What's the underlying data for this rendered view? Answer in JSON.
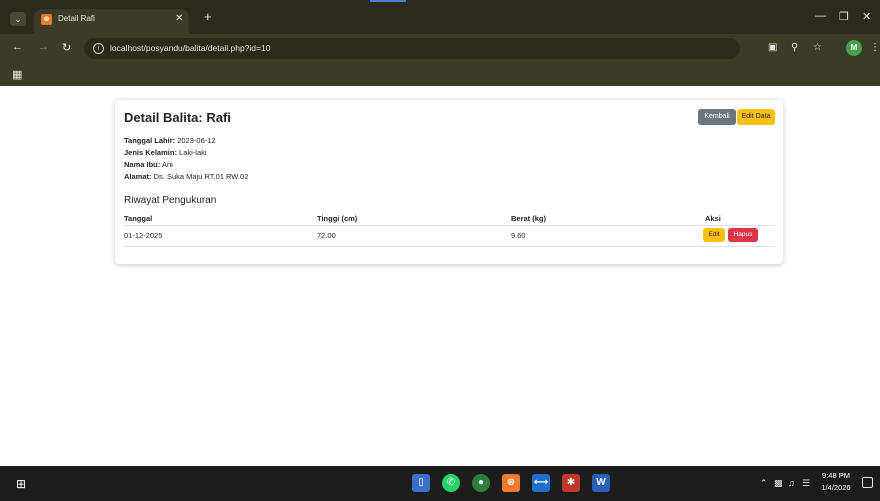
{
  "browser": {
    "tab_title": "Detail Rafi",
    "tab_favicon": "XAMPP",
    "url": "localhost/posyandu/balita/detail.php?id=10",
    "profile_initial": "M"
  },
  "page": {
    "title": "Detail Balita: Rafi",
    "buttons": {
      "kembali": "Kembali",
      "edit_data": "Edit Data"
    },
    "info": [
      {
        "label": "Tanggal Lahir:",
        "value": "2023-06-12"
      },
      {
        "label": "Jenis Kelamin:",
        "value": "Laki-laki"
      },
      {
        "label": "Nama Ibu:",
        "value": "Ani"
      },
      {
        "label": "Alamat:",
        "value": "Ds. Suka Maju RT.01 RW.02"
      }
    ],
    "history_title": "Riwayat Pengukuran",
    "table": {
      "headers": [
        "Tanggal",
        "Tinggi (cm)",
        "Berat (kg)",
        "Aksi"
      ],
      "rows": [
        {
          "tanggal": "01-12-2025",
          "tinggi": "72.00",
          "berat": "9.60",
          "edit": "Edit",
          "hapus": "Hapus"
        }
      ]
    }
  },
  "taskbar": {
    "time": "9:48 PM",
    "date": "1/4/2026"
  },
  "colors": {
    "btn_secondary": "#6c757d",
    "btn_warning": "#ffc107",
    "btn_danger": "#dc3545",
    "browser_chrome": "#3c3b27"
  }
}
